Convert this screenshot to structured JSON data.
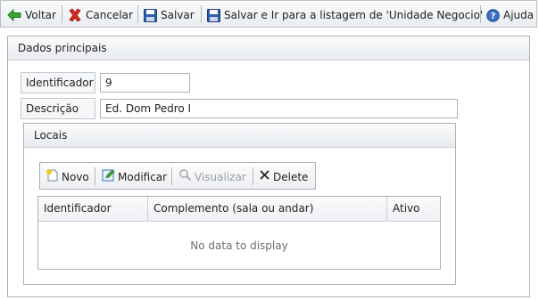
{
  "toolbar": {
    "back_label": "Voltar",
    "cancel_label": "Cancelar",
    "save_label": "Salvar",
    "save_and_list_label": "Salvar e Ir para a listagem de 'Unidade Negocio'",
    "help_label": "Ajuda"
  },
  "main_panel": {
    "title": "Dados principais",
    "fields": {
      "identificador_label": "Identificador",
      "identificador_value": "9",
      "descricao_label": "Descrição",
      "descricao_value": "Ed. Dom Pedro I"
    }
  },
  "locais": {
    "title": "Locais",
    "toolbar": {
      "new_label": "Novo",
      "edit_label": "Modificar",
      "view_label": "Visualizar",
      "delete_label": "Delete"
    },
    "grid": {
      "columns": [
        "Identificador",
        "Complemento (sala ou andar)",
        "Ativo"
      ],
      "empty_text": "No data to display"
    }
  },
  "colors": {
    "back_arrow": "#3aa635",
    "cancel_x": "#d9281c",
    "save_disk": "#2f5fa8",
    "help_icon": "#3a6fc4"
  }
}
